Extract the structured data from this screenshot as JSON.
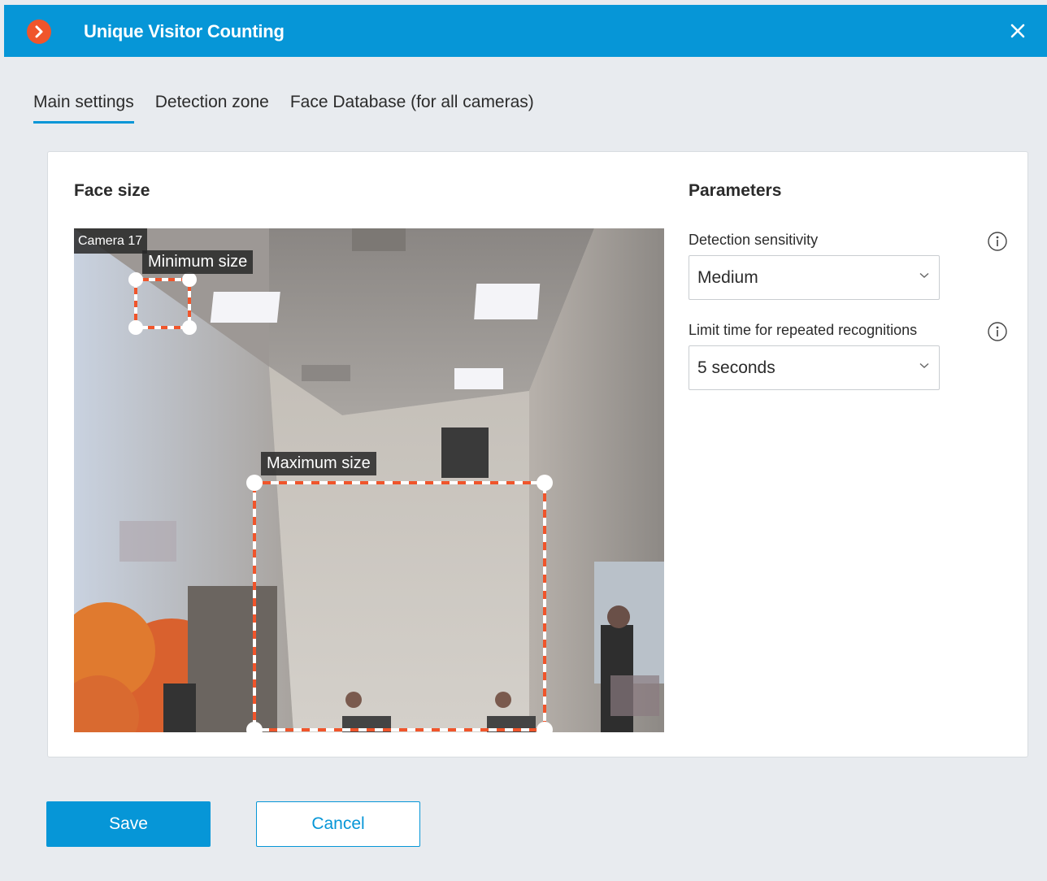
{
  "window": {
    "title": "Unique Visitor Counting"
  },
  "tabs": [
    {
      "label": "Main settings",
      "active": true
    },
    {
      "label": "Detection zone",
      "active": false
    },
    {
      "label": "Face Database (for all cameras)",
      "active": false
    }
  ],
  "face_size": {
    "title": "Face size",
    "camera_label": "Camera 17",
    "min_label": "Minimum size",
    "max_label": "Maximum size"
  },
  "parameters": {
    "title": "Parameters",
    "sensitivity": {
      "label": "Detection sensitivity",
      "value": "Medium"
    },
    "limit_time": {
      "label": "Limit time for repeated recognitions",
      "value": "5 seconds"
    }
  },
  "footer": {
    "save_label": "Save",
    "cancel_label": "Cancel"
  },
  "colors": {
    "accent": "#0696d7",
    "logo": "#f0552b",
    "zone_stroke": "#f0552b"
  },
  "icons": {
    "logo": "chevron-right-icon",
    "close": "close-icon",
    "info": "info-icon",
    "dropdown": "chevron-down-icon"
  }
}
